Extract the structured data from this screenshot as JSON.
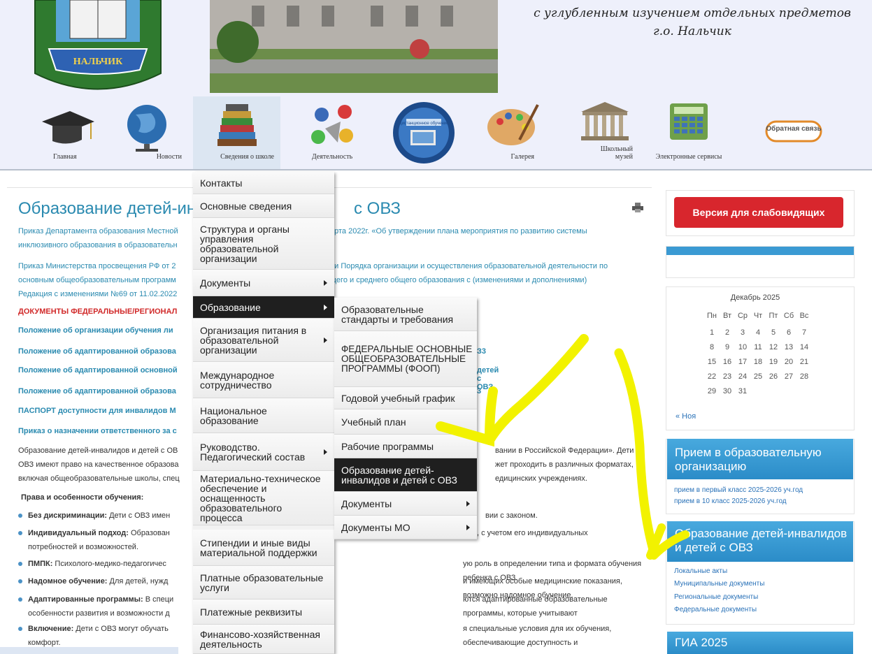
{
  "header": {
    "school_name_line1": "с углубленным изучением отдельных предметов",
    "school_name_line2": "г.о. Нальчик",
    "logo_text": "НАЛЬЧИК"
  },
  "nav": [
    {
      "label": "Главная",
      "icon": "graduation-cap-icon"
    },
    {
      "label": "Новости",
      "icon": "globe-icon"
    },
    {
      "label": "Сведения о школе",
      "icon": "books-icon"
    },
    {
      "label": "Деятельность",
      "icon": "activity-icon"
    },
    {
      "label": "",
      "icon": "distance-learning-icon",
      "image_text": "Дистанционное обучение"
    },
    {
      "label": "Галерея",
      "icon": "palette-icon"
    },
    {
      "label": "Школьный музей",
      "icon": "museum-icon"
    },
    {
      "label": "Электронные сервисы",
      "icon": "calculator-icon"
    },
    {
      "label": "",
      "icon": "feedback-icon",
      "image_text": "Обратная связь"
    }
  ],
  "main": {
    "title": "Образование детей-ин",
    "title_tail": "с ОВЗ",
    "p1_left": "Приказ Департамента образования Местной",
    "p1_right": "арта 2022г. «Об утверждении плана мероприятия по развитию системы",
    "p1_line2": "инклюзивного образования в образовательн",
    "p2_left": "Приказ Министерства просвещения РФ от 2",
    "p2_right": "ии Порядка организации и осуществления образовательной деятельности по",
    "p2_line2_left": "основным общеобразовательным программ",
    "p2_line2_right": "щего и среднего общего образования с (изменениями и дополнениями)",
    "p2_line3": "Редакция с изменениями №69 от 11.02.2022",
    "docs_heading": "ДОКУМЕНТЫ ФЕДЕРАЛЬНЫЕ/РЕГИОНАЛ",
    "links": [
      {
        "left": "Положение об организации обучения ли",
        "right": ""
      },
      {
        "left": "Положение об адаптированной образова",
        "right": "З3"
      },
      {
        "left": "Положение об адаптированной основной",
        "right": "детей с ОВЗ"
      },
      {
        "left": "Положение об адаптированной образова",
        "right": "3"
      },
      {
        "left": "ПАСПОРТ доступности для инвалидов М",
        "right": ""
      },
      {
        "left": "Приказ о назначении ответственного за с",
        "right": ""
      }
    ],
    "body1_left": "Образование детей-инвалидов и детей с ОВ",
    "body1_right": "вании в Российской Федерации». Дети с",
    "body2_left": "ОВЗ имеют право на качественное образова",
    "body2_right": "жет проходить в различных форматах,",
    "body3_left": "включая общеобразовательные школы, спец",
    "body3_right": "едицинских учреждениях.",
    "rights_heading": "Права и особенности обучения:",
    "bullets": [
      {
        "bold": "Без дискриминации:",
        "text": " Дети с ОВЗ имен",
        "right": "вии с законом."
      },
      {
        "bold": "Индивидуальный подход:",
        "text": " Образован",
        "right": ", с учетом его индивидуальных",
        "line2": "потребностей и возможностей."
      },
      {
        "bold": "ПМПК:",
        "text": " Психолого-медико-педагогичес",
        "right": "ую роль в определении типа и формата обучения ребенка с ОВЗ."
      },
      {
        "bold": "Надомное обучение:",
        "text": " Для детей, нужд",
        "right": "и имеющих особые медицинские показания, возможно надомное обучение."
      },
      {
        "bold": "Адаптированные программы:",
        "text": " В специ",
        "right": "ются адаптированные образовательные программы, которые учитывают",
        "line2": "особенности развития и возможности д"
      },
      {
        "bold": "Включение:",
        "text": " Дети с ОВЗ могут обучать",
        "right": "я специальные условия для их обучения, обеспечивающие доступность и",
        "line2": "комфорт."
      }
    ]
  },
  "menu": {
    "items": [
      {
        "label": "Контакты",
        "arrow": false
      },
      {
        "label": "Основные сведения",
        "arrow": false
      },
      {
        "label": "Структура и органы управления образовательной организации",
        "arrow": false
      },
      {
        "label": "Документы",
        "arrow": true
      },
      {
        "label": "Образование",
        "arrow": true,
        "selected": true
      },
      {
        "label": "Организация питания в образовательной организации",
        "arrow": true
      },
      {
        "label": "Международное сотрудничество",
        "arrow": false
      },
      {
        "label": "Национальное образование",
        "arrow": false
      },
      {
        "label": "Руководство. Педагогический состав",
        "arrow": true
      },
      {
        "label": "Материально-техническое обеспечение и оснащенность образовательного процесса",
        "arrow": false
      },
      {
        "label": "Стипендии и иные виды материальной поддержки",
        "arrow": false
      },
      {
        "label": "Платные образовательные услуги",
        "arrow": false
      },
      {
        "label": "Платежные реквизиты",
        "arrow": false
      },
      {
        "label": "Финансово-хозяйственная деятельность",
        "arrow": false
      }
    ],
    "submenu": [
      {
        "label": "Образовательные стандарты и требования",
        "arrow": false
      },
      {
        "label": "ФЕДЕРАЛЬНЫЕ ОСНОВНЫЕ ОБЩЕОБРАЗОВАТЕЛЬНЫЕ ПРОГРАММЫ (ФООП)",
        "arrow": false
      },
      {
        "label": "Годовой учебный график",
        "arrow": false
      },
      {
        "label": "Учебный план",
        "arrow": false
      },
      {
        "label": "Рабочие программы",
        "arrow": false
      },
      {
        "label": "Образование детей-инвалидов и детей с ОВЗ",
        "arrow": false,
        "selected": true
      },
      {
        "label": "Документы",
        "arrow": true
      },
      {
        "label": "Документы МО",
        "arrow": true
      }
    ]
  },
  "sidebar": {
    "vision_button": "Версия для слабовидящих",
    "calendar": {
      "title": "Декабрь 2025",
      "weekdays": [
        "Пн",
        "Вт",
        "Ср",
        "Чт",
        "Пт",
        "Сб",
        "Вс"
      ],
      "weeks": [
        [
          "1",
          "2",
          "3",
          "4",
          "5",
          "6",
          "7"
        ],
        [
          "8",
          "9",
          "10",
          "11",
          "12",
          "13",
          "14"
        ],
        [
          "15",
          "16",
          "17",
          "18",
          "19",
          "20",
          "21"
        ],
        [
          "22",
          "23",
          "24",
          "25",
          "26",
          "27",
          "28"
        ],
        [
          "29",
          "30",
          "31",
          "",
          "",
          "",
          ""
        ]
      ],
      "prev": "« Ноя"
    },
    "admission": {
      "title": "Прием в образовательную организацию",
      "links": [
        "прием в первый класс 2025-2026 уч.год",
        "прием в 10 класс 2025-2026 уч.год"
      ]
    },
    "ovz": {
      "title": "Образование детей-инвалидов и детей с ОВЗ",
      "links": [
        "Локальные акты",
        "Муниципальные документы",
        "Региональные документы",
        "Федеральные документы"
      ]
    },
    "gia": {
      "title": "ГИА 2025"
    }
  },
  "colors": {
    "accent": "#2a8ab0",
    "red_button": "#d8262d",
    "menu_selected": "#1f1f1f",
    "panel_blue": "#2b8cc8",
    "highlight": "#f2f200"
  }
}
